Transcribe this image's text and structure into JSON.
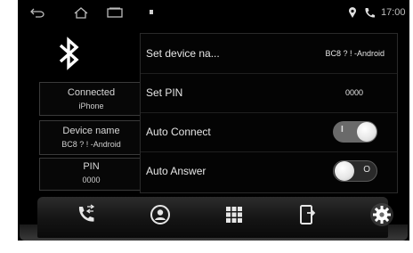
{
  "status_bar": {
    "nav_icons": [
      "back-icon",
      "home-icon",
      "recents-icon"
    ],
    "notification_icon": "notification-dot-icon",
    "location_icon": "location-icon",
    "call_icon": "phone-icon",
    "time": "17:00"
  },
  "left_panel": {
    "logo_icon": "bluetooth-icon",
    "connection": {
      "title": "Connected",
      "value": "iPhone"
    },
    "device": {
      "title": "Device name",
      "value": "BC8 ? ! -Android"
    },
    "pin": {
      "title": "PIN",
      "value": "0000"
    }
  },
  "settings": {
    "device_name": {
      "label": "Set device na...",
      "value": "BC8 ? ! -Android"
    },
    "pin": {
      "label": "Set PIN",
      "value": "0000"
    },
    "auto_connect": {
      "label": "Auto Connect",
      "state": "on",
      "mark": "I"
    },
    "auto_answer": {
      "label": "Auto Answer",
      "state": "off",
      "mark": "O"
    }
  },
  "dock": {
    "items": [
      "phone-icon",
      "contacts-icon",
      "dialpad-icon",
      "phone-transfer-icon",
      "settings-gear-icon"
    ],
    "active": "settings-gear-icon"
  },
  "colors": {
    "background": "#000000",
    "panel_border": "#3a3a3a",
    "text": "#e6e6e6"
  }
}
